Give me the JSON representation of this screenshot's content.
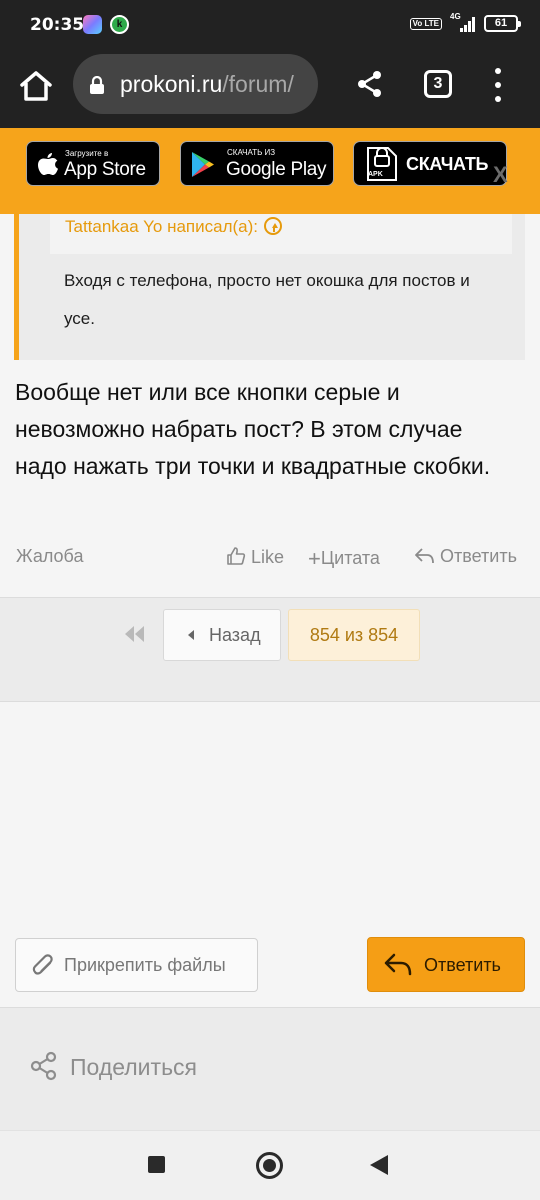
{
  "status_bar": {
    "time": "20:35",
    "volte": "Vo LTE",
    "network": "4G",
    "battery": "61"
  },
  "browser": {
    "url_domain": "prokoni.ru",
    "url_path": "/forum/",
    "tab_count": "3"
  },
  "app_banner": {
    "appstore_small": "Загрузите в",
    "appstore_big": "App Store",
    "gplay_small": "СКАЧАТЬ ИЗ",
    "gplay_big": "Google Play",
    "apk_label": "APK",
    "apk_big": "СКАЧАТЬ",
    "close": "X"
  },
  "post": {
    "quote_author": "Tattankaa Yo написал(а):",
    "quote_text": "Входя с телефона, просто нет окошка для постов и усе.",
    "text": "Вообще нет или все кнопки серые и невозможно набрать пост? В этом случае надо нажать три точки и квадратные скобки.",
    "report": "Жалоба",
    "like": "Like",
    "quote": "Цитата",
    "reply": "Ответить"
  },
  "pagination": {
    "back": "Назад",
    "current": "854 из 854"
  },
  "composer": {
    "attach": "Прикрепить файлы",
    "submit": "Ответить"
  },
  "share": {
    "label": "Поделиться"
  },
  "colors": {
    "accent": "#f6a41b",
    "dark_bar": "#222222",
    "link_orange": "#e69a0c"
  }
}
